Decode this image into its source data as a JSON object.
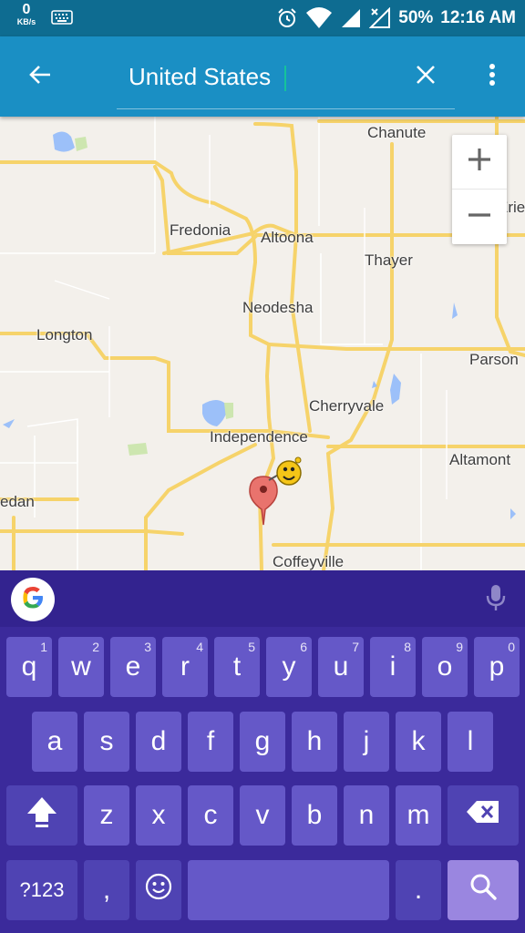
{
  "status_bar": {
    "net_speed_value": "0",
    "net_speed_unit": "KB/s",
    "battery": "50%",
    "time": "12:16 AM"
  },
  "toolbar": {
    "search_value": "United States",
    "icons": {
      "back": "back-arrow-icon",
      "clear": "close-icon",
      "more": "more-vert-icon"
    }
  },
  "map": {
    "labels": {
      "chanute": "Chanute",
      "erie": "Erie",
      "fredonia": "Fredonia",
      "altoona": "Altoona",
      "thayer": "Thayer",
      "neodesha": "Neodesha",
      "longton": "Longton",
      "parsons": "Parson",
      "cherryvale": "Cherryvale",
      "independence": "Independence",
      "altamont": "Altamont",
      "sedan": "edan",
      "coffeyville": "Coffeyville"
    },
    "zoom_in": "+",
    "zoom_out": "−",
    "colors": {
      "land": "#f3f0eb",
      "road": "#f6d36a",
      "water": "#9cc0f9",
      "park": "#cde6b0"
    }
  },
  "keyboard": {
    "row1": [
      {
        "label": "q",
        "hint": "1"
      },
      {
        "label": "w",
        "hint": "2"
      },
      {
        "label": "e",
        "hint": "3"
      },
      {
        "label": "r",
        "hint": "4"
      },
      {
        "label": "t",
        "hint": "5"
      },
      {
        "label": "y",
        "hint": "6"
      },
      {
        "label": "u",
        "hint": "7"
      },
      {
        "label": "i",
        "hint": "8"
      },
      {
        "label": "o",
        "hint": "9"
      },
      {
        "label": "p",
        "hint": "0"
      }
    ],
    "row2": [
      "a",
      "s",
      "d",
      "f",
      "g",
      "h",
      "j",
      "k",
      "l"
    ],
    "row3": [
      "z",
      "x",
      "c",
      "v",
      "b",
      "n",
      "m"
    ],
    "symbols_label": "?123",
    "comma_label": ",",
    "period_label": ".",
    "colors": {
      "background": "#3b2a9b",
      "key": "#6558c8",
      "enter": "#9a86e0"
    }
  }
}
